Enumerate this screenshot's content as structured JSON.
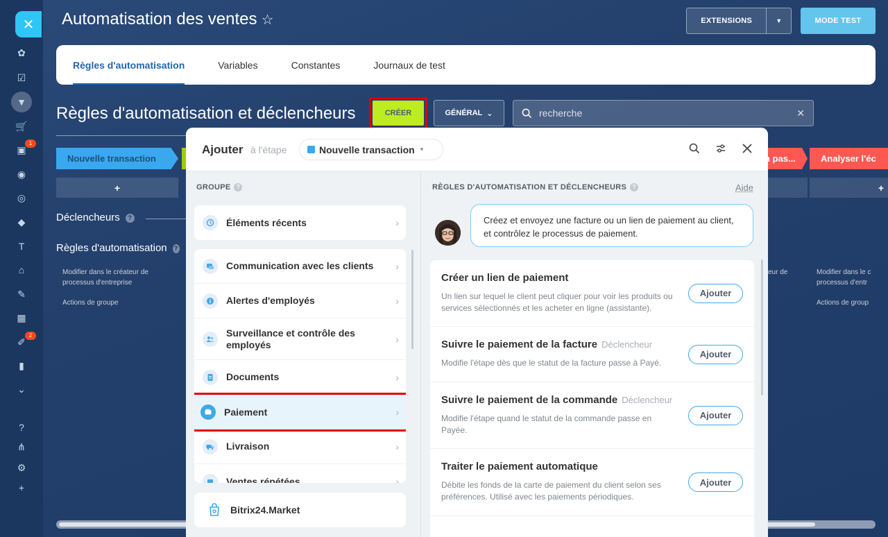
{
  "window": {
    "title": "Automatisation des ventes",
    "extensions_label": "EXTENSIONS",
    "test_mode_label": "MODE TEST"
  },
  "sidebar": {
    "badges": [
      "1",
      "2"
    ]
  },
  "tabs": [
    {
      "label": "Règles d'automatisation",
      "active": true
    },
    {
      "label": "Variables",
      "active": false
    },
    {
      "label": "Constantes",
      "active": false
    },
    {
      "label": "Journaux de test",
      "active": false
    }
  ],
  "toolbar": {
    "section_title": "Règles d'automatisation et déclencheurs",
    "create_label": "CRÉER",
    "general_label": "GÉNÉRAL",
    "search_placeholder": "recherche"
  },
  "stages": {
    "first": "Nouvelle transaction",
    "red1": "n pas...",
    "red2": "Analyser l'éc",
    "plus": "+"
  },
  "background": {
    "triggers_label": "Déclencheurs",
    "rules_label": "Règles d'automatisation",
    "left_action_1": "Modifier dans le créateur de processus d'entreprise",
    "left_action_2": "Actions de groupe",
    "right_partial_1": "eur de",
    "right_action_1": "Modifier dans le c processus d'entr",
    "right_action_2": "Actions de group"
  },
  "modal": {
    "title": "Ajouter",
    "subtitle": "à l'étape",
    "stage_name": "Nouvelle transaction",
    "group_header": "GROUPE",
    "rules_header": "RÈGLES D'AUTOMATISATION ET DÉCLENCHEURS",
    "help_label": "Aide",
    "recent": "Éléments récents",
    "groups": [
      "Communication avec les clients",
      "Alertes d'employés",
      "Surveillance et contrôle des employés",
      "Documents",
      "Paiement",
      "Livraison",
      "Ventes répétées"
    ],
    "market": "Bitrix24.Market",
    "bubble_text": "Créez et envoyez une facture ou un lien de paiement au client, et contrôlez le processus de paiement.",
    "rules": [
      {
        "title": "Créer un lien de paiement",
        "tag": "",
        "desc": "Un lien sur lequel le client peut cliquer pour voir les produits ou services sélectionnés et les acheter en ligne (assistante).",
        "button": "Ajouter"
      },
      {
        "title": "Suivre le paiement de la facture",
        "tag": "Déclencheur",
        "desc": "Modifie l'étape dès que le statut de la facture passe à Payé.",
        "button": "Ajouter"
      },
      {
        "title": "Suivre le paiement de la commande",
        "tag": "Déclencheur",
        "desc": "Modifie l'étape quand le statut de la commande passe en Payée.",
        "button": "Ajouter"
      },
      {
        "title": "Traiter le paiement automatique",
        "tag": "",
        "desc": "Débite les fonds de la carte de paiement du client selon ses préférences. Utilisé avec les paiements périodiques.",
        "button": "Ajouter"
      }
    ]
  },
  "colors": {
    "accent": "#2fc6f6",
    "create": "#bbed21",
    "highlight": "#e10000",
    "stage_blue": "#39a8ef",
    "stage_red": "#ff5752"
  }
}
